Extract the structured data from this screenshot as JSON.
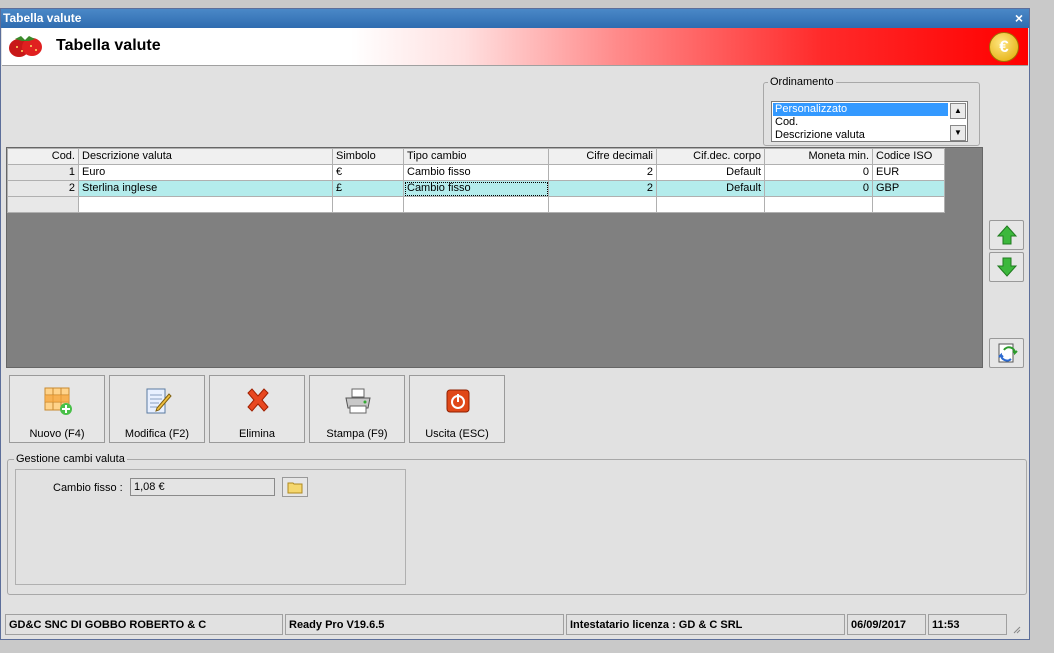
{
  "window": {
    "title": "Tabella valute",
    "close_glyph": "×"
  },
  "header": {
    "title": "Tabella valute",
    "logo_icon": "strawberry-icon",
    "coin_icon": "euro-coin-icon",
    "coin_glyph": "€"
  },
  "ordinamento": {
    "legend": "Ordinamento",
    "options": [
      "Personalizzato",
      "Cod.",
      "Descrizione valuta"
    ],
    "selected": "Personalizzato"
  },
  "grid": {
    "columns": [
      "Cod.",
      "Descrizione valuta",
      "Simbolo",
      "Tipo cambio",
      "Cifre decimali",
      "Cif.dec. corpo",
      "Moneta min.",
      "Codice ISO"
    ],
    "rows": [
      [
        "1",
        "Euro",
        "€",
        "Cambio fisso",
        "2",
        "Default",
        "0",
        "EUR"
      ],
      [
        "2",
        "Sterlina inglese",
        "£",
        "Cambio fisso",
        "2",
        "Default",
        "0",
        "GBP"
      ]
    ],
    "selected_row": 1
  },
  "toolbar": {
    "new": "Nuovo (F4)",
    "edit": "Modifica (F2)",
    "delete": "Elimina",
    "print": "Stampa (F9)",
    "exit": "Uscita (ESC)"
  },
  "gestione": {
    "legend": "Gestione cambi valuta",
    "cambio_label": "Cambio fisso :",
    "cambio_value": "1,08 €"
  },
  "statusbar": {
    "company": "GD&C SNC DI GOBBO ROBERTO & C",
    "version": "Ready Pro V19.6.5",
    "license": "Intestatario licenza : GD & C SRL",
    "date": "06/09/2017",
    "time": "11:53"
  },
  "colors": {
    "selected_row": "#b4ecec",
    "title_bar": "#2f6cb0",
    "header_red": "#ff0000",
    "up_arrow": "#3cb83c"
  }
}
